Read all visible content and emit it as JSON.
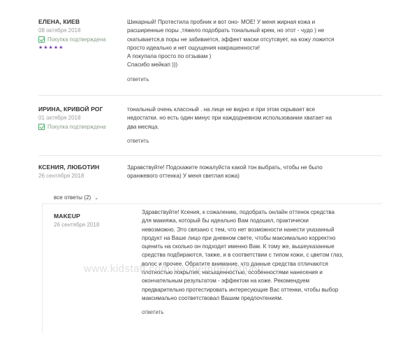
{
  "reviews": [
    {
      "author": "ЕЛЕНА, КИЕВ",
      "date": "08 октября 2018",
      "verified": "Покупка подтверждена",
      "stars": "★★★★★",
      "lines": [
        "Шикарный! Протестила пробник и вот оно- МОЕ! У меня жирная кожа и",
        "расширенные поры ,тяжело подобрать тональный крем, но этот - чудо ) не",
        "скатывается,в поры не забивается, эффект маски отсутсвует, на кожу ложится",
        "просто идеально и нет ощущения накрашенности!",
        "А покупала просто по отзывам )",
        "Спасибо мейкап )))"
      ],
      "reply": "ответить"
    },
    {
      "author": "ИРИНА, КРИВОЙ РОГ",
      "date": "01 октября 2018",
      "verified": "Покупка подтверждена",
      "lines": [
        "тональный очень классный . на лице не видно и при этом скрывает все",
        "недостатки. но есть один минус при каждодневном использовании хватает на",
        "два месяца."
      ],
      "reply": "ответить"
    },
    {
      "author": "КСЕНИЯ, ЛЮБОТИН",
      "date": "26 сентября 2018",
      "lines": [
        "Здравствуйте! Подскажите пожалуйста какой тон выбрать, чтобы не было",
        "оранжевого оттенка) У меня светлая кожа)"
      ]
    }
  ],
  "answers_toggle": "все ответы (2)",
  "answer": {
    "author": "MAKEUP",
    "date": "26 сентября 2018",
    "lines": [
      "Здравствуйте! Ксения, к сожалению, подобрать онлайн оттенок средства",
      "для макияжа, который бы идеально Вам подошел, практически",
      "невозможно. Это связано с тем, что нет возможности нанести указанный",
      "продукт на Ваше лицо при дневном свете, чтобы максимально корректно",
      "оценить на сколько он подходит именно Вам. К тому же, вышеуказанные",
      "средства подбираются, также, и в соответствии с типом кожи, с цветом глаз,",
      "волос и прочее. Обратите внимание, что данные средства отличаются",
      "плотностью покрытия, насыщенностью, особенностями нанесения и",
      "окончательным результатом - эффектом на коже. Рекомендуем",
      "предварительно протестировать интересующие Вас оттенки, чтобы выбор",
      "максимально соответствовал Вашим предпочтениям."
    ],
    "reply": "ответить"
  },
  "watermark": "www.kidstaff.com.ua/member/40060"
}
